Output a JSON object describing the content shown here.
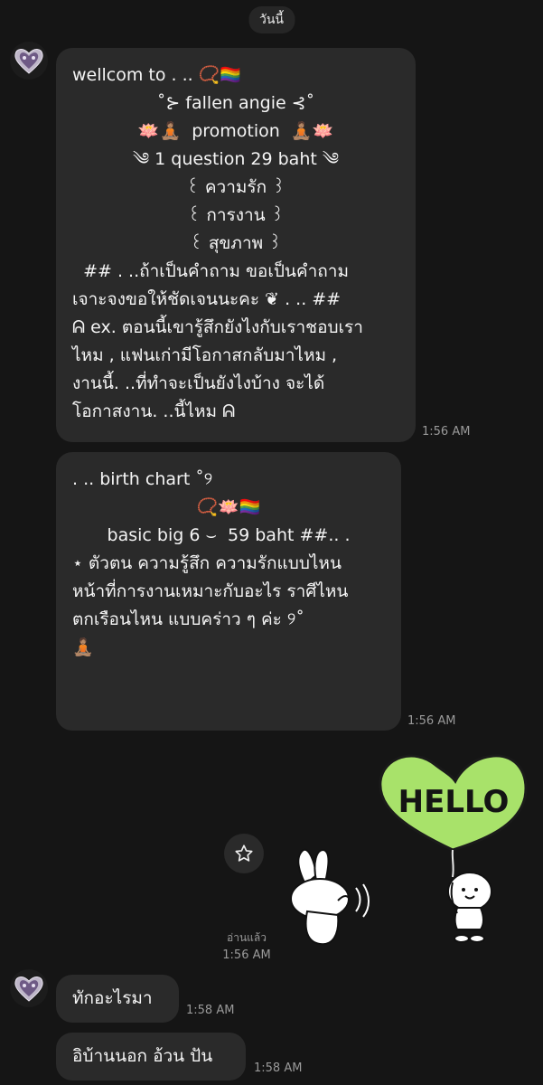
{
  "header": {
    "date_label": "วันนี้"
  },
  "messages": [
    {
      "lines": [
        "wellcom to . .. 📿🏳️‍🌈",
        "˚⊱ fallen angie ⊰˚",
        "🪷🧘🏽  promotion  🧘🏽🪷",
        "༄ 1 question 29 baht ༄",
        "꒰ ความรัก ꒱",
        "꒰ การงาน ꒱",
        "꒰ สุขภาพ ꒱",
        "  ## . ..ถ้าเป็นคำถาม ขอเป็นคำถาม",
        "เจาะจงขอให้ชัดเจนนะคะ ❦ . .. ##",
        "ᕱ ex. ตอนนี้เขารู้สึกยังไงกับเราชอบเรา",
        "ไหม , แฟนเก่ามีโอกาสกลับมาไหม ,",
        "งานนี้. ..ที่ทำจะเป็นยังไงบ้าง จะได้",
        "โอกาสงาน. ..นี้ไหม ᕱ"
      ],
      "time": "1:56 AM"
    },
    {
      "lines": [
        ". .. birth chart ˚୨",
        "",
        "📿🪷🏳️‍🌈",
        "basic big 6 ⌣  59 baht ##.. .",
        "",
        "⋆ ตัวตน ความรู้สึก ความรักแบบไหน",
        "หน้าที่การงานเหมาะกับอะไร ราศีไหน",
        "ตกเรือนไหน แบบคร่าว ๆ ค่ะ ୨˚",
        "🧘🏽"
      ],
      "time": "1:56 AM"
    },
    {
      "text": "ทักอะไรมา",
      "time": "1:58 AM"
    },
    {
      "text": "อิบ้านนอก อ้วน ปัน",
      "time": "1:58 AM"
    }
  ],
  "sticker": {
    "text": "HELLO",
    "read_label": "อ่านแล้ว",
    "time": "1:56 AM"
  },
  "icons": {
    "avatar": "heart-gem-avatar-icon",
    "star": "star-icon"
  },
  "colors": {
    "background": "#151515",
    "bubble": "#2a2a2a",
    "heart": "#a8e26a"
  }
}
